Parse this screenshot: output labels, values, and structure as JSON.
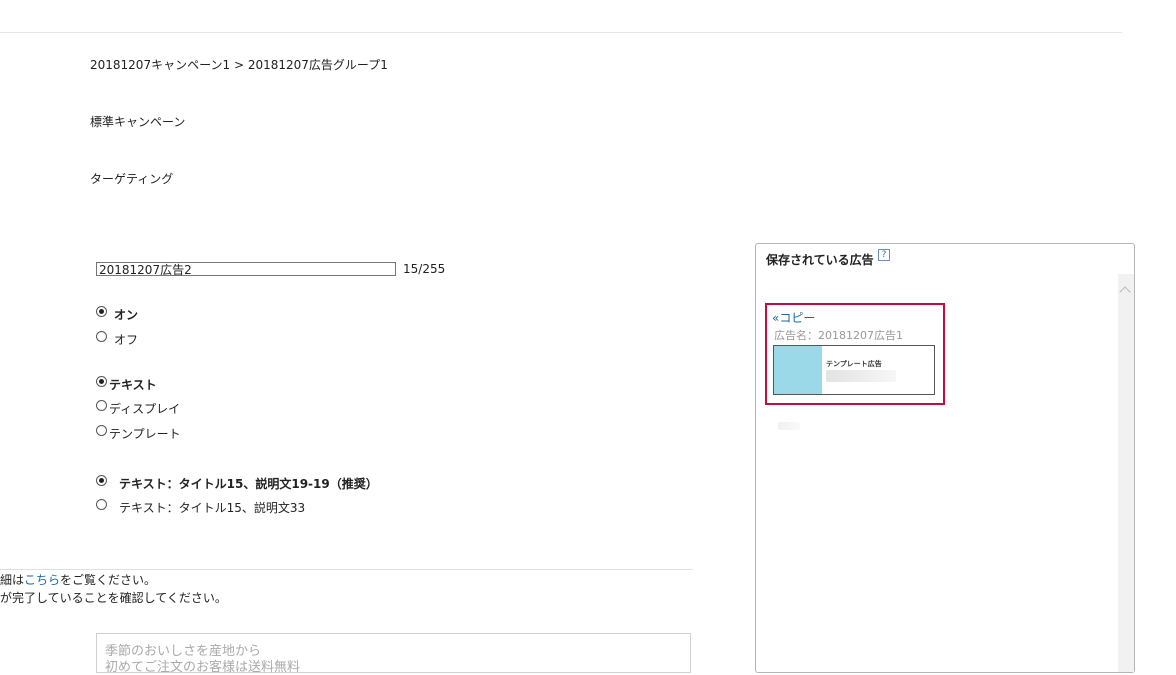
{
  "breadcrumb": {
    "campaign": "20181207キャンペーン1",
    "separator": ">",
    "ad_group": "20181207広告グループ1"
  },
  "campaign_type": "標準キャンペーン",
  "section_label": "ターゲティング",
  "ad_name_field": {
    "value": "20181207広告2",
    "counter": "15/255"
  },
  "status_radios": [
    {
      "label": "オン",
      "selected": true
    },
    {
      "label": "オフ",
      "selected": false
    }
  ],
  "ad_type_radios": [
    {
      "label": "テキスト",
      "selected": true
    },
    {
      "label": "ディスプレイ",
      "selected": false
    },
    {
      "label": "テンプレート",
      "selected": false
    }
  ],
  "format_radios": [
    {
      "label": "テキスト：タイトル15、説明文19-19（推奨）",
      "selected": true
    },
    {
      "label": "テキスト：タイトル15、説明文33",
      "selected": false
    }
  ],
  "notice": {
    "line1_prefix": "細は",
    "line1_link": "こちら",
    "line1_suffix": "をご覧ください。",
    "line2": "が完了していることを確認してください。"
  },
  "preview": {
    "line1": "季節のおいしさを産地から",
    "line2": "初めてご注文のお客様は送料無料"
  },
  "saved_ads_panel": {
    "title": "保存されている広告",
    "help_label": "?",
    "card": {
      "copy_label": "«コピー",
      "ad_name": "広告名：20181207広告1",
      "thumbnail_title": "テンプレート広告",
      "thumbnail_color": "#9bd9e9"
    },
    "highlight_color": "#c30d3b"
  }
}
